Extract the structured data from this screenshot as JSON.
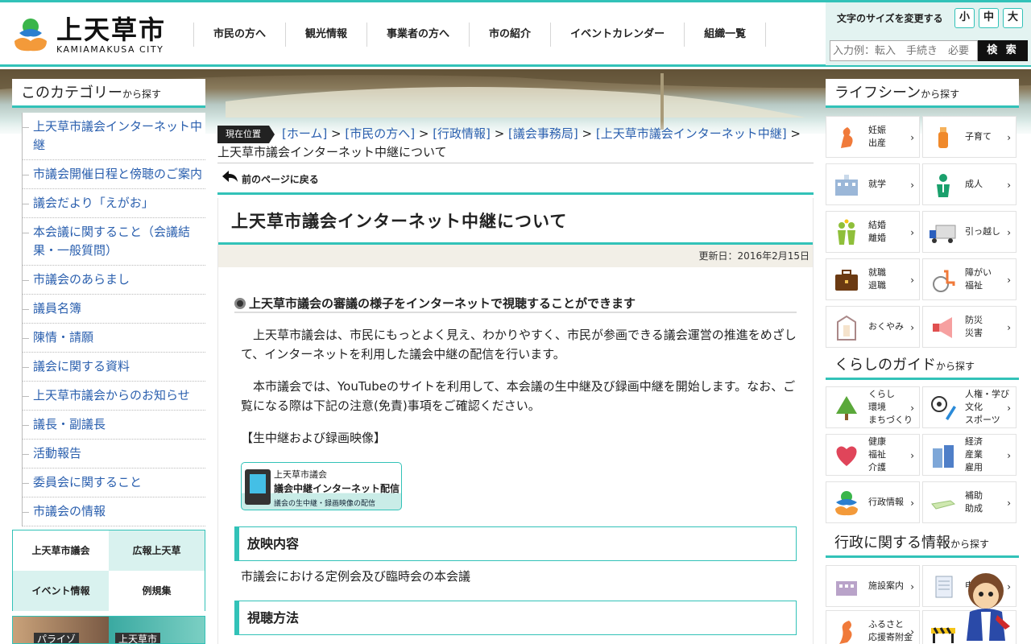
{
  "header": {
    "logo_title": "上天草市",
    "logo_sub": "KAMIAMAKUSA CITY",
    "nav": [
      "市民の方へ",
      "観光情報",
      "事業者の方へ",
      "市の紹介",
      "イベントカレンダー",
      "組織一覧"
    ],
    "font_size_label": "文字のサイズを変更する",
    "font_sizes": [
      "小",
      "中",
      "大"
    ],
    "search_placeholder": "入力例：転入　手続き　必要",
    "search_button": "検 索"
  },
  "left_sidebar": {
    "title_big": "このカテゴリー",
    "title_small": "から探す",
    "items": [
      "上天草市議会インターネット中継",
      "市議会開催日程と傍聴のご案内",
      "議会だより「えがお」",
      "本会議に関すること（会議結果・一般質問）",
      "市議会のあらまし",
      "議員名簿",
      "陳情・請願",
      "議会に関する資料",
      "上天草市議会からのお知らせ",
      "議長・副議長",
      "活動報告",
      "委員会に関すること",
      "市議会の情報"
    ],
    "banners": [
      "上天草市議会",
      "広報上天草",
      "イベント情報",
      "例規集"
    ],
    "photo_banners": [
      "パライゾ",
      "上天草市"
    ]
  },
  "breadcrumb": {
    "label": "現在位置",
    "links": [
      "[ホーム]",
      "[市民の方へ]",
      "[行政情報]",
      "[議会事務局]",
      "[上天草市議会インターネット中継]"
    ],
    "separator": " > ",
    "current": "上天草市議会インターネット中継について"
  },
  "back_link": "前のページに戻る",
  "page": {
    "title": "上天草市議会インターネット中継について",
    "updated": "更新日：2016年2月15日",
    "section_heading": "上天草市議会の審議の様子をインターネットで視聴することができます",
    "para1": "　上天草市議会は、市民にもっとよく見え、わかりやすく、市民が参画できる議会運営の推進をめざして、インターネットを利用した議会中継の配信を行います。",
    "para2": "　本市議会では、YouTubeのサイトを利用して、本会議の生中継及び録画中継を開始します。なお、ご覧になる際は下記の注意(免責)事項をご確認ください。",
    "video_label": "【生中継および録画映像】",
    "media_banner": {
      "line1": "上天草市議会",
      "line2": "議会中継インターネット配信",
      "line3": "議会の生中継・録画映像の配信"
    },
    "box1_title": "放映内容",
    "box1_text": "市議会における定例会及び臨時会の本会議",
    "box2_title": "視聴方法"
  },
  "right_sidebar": {
    "life_title_big": "ライフシーン",
    "life_title_small": "から探す",
    "life_tiles": [
      {
        "label": "妊娠\n出産",
        "icon": "pregnancy-icon"
      },
      {
        "label": "子育て",
        "icon": "baby-bottle-icon"
      },
      {
        "label": "就学",
        "icon": "school-icon"
      },
      {
        "label": "成人",
        "icon": "adult-icon"
      },
      {
        "label": "結婚\n離婚",
        "icon": "couple-icon"
      },
      {
        "label": "引っ越し",
        "icon": "truck-icon"
      },
      {
        "label": "就職\n退職",
        "icon": "briefcase-icon"
      },
      {
        "label": "障がい\n福祉",
        "icon": "wheelchair-icon"
      },
      {
        "label": "おくやみ",
        "icon": "funeral-icon"
      },
      {
        "label": "防災\n災害",
        "icon": "megaphone-icon"
      }
    ],
    "guide_title_big": "くらしのガイド",
    "guide_title_small": "から探す",
    "guide_tiles": [
      {
        "label": "くらし\n環境\nまちづくり",
        "icon": "tree-icon"
      },
      {
        "label": "人権・学び\n文化\nスポーツ",
        "icon": "soccer-pencil-icon"
      },
      {
        "label": "健康\n福祉\n介護",
        "icon": "heart-icon"
      },
      {
        "label": "経済\n産業\n雇用",
        "icon": "buildings-icon"
      },
      {
        "label": "行政情報",
        "icon": "city-logo-icon"
      },
      {
        "label": "補助\n助成",
        "icon": "money-icon"
      }
    ],
    "admin_title_big": "行政に関する情報",
    "admin_title_small": "から探す",
    "admin_tiles": [
      {
        "label": "施設案内",
        "icon": "facility-icon"
      },
      {
        "label": "申請書",
        "icon": "document-icon"
      },
      {
        "label": "ふるさと\n応援寄附金",
        "icon": "map-icon"
      },
      {
        "label": "",
        "icon": "barrier-icon"
      }
    ]
  },
  "colors": {
    "accent": "#32c2b8",
    "link": "#2a5fae",
    "updated_bg": "#f2efe7"
  }
}
